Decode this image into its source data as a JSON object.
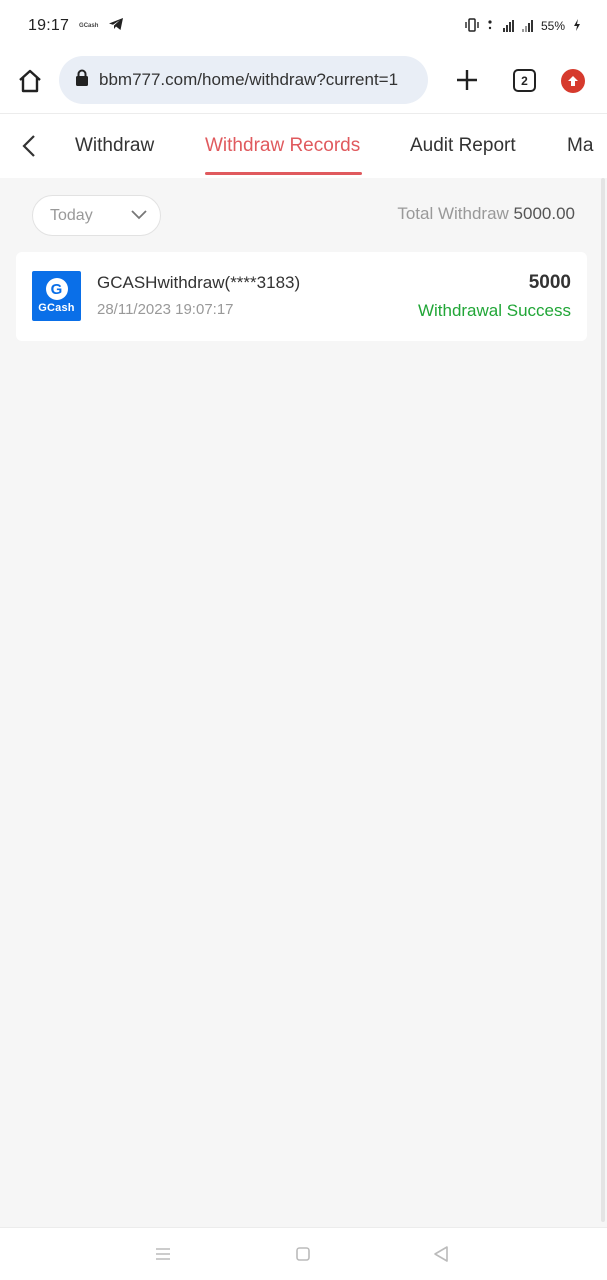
{
  "status_bar": {
    "time": "19:17",
    "app_badge": "GCash",
    "battery": "55%"
  },
  "browser": {
    "url": "bbm777.com/home/withdraw?current=1",
    "tab_count": "2"
  },
  "nav_tabs": [
    {
      "label": "Withdraw",
      "active": false
    },
    {
      "label": "Withdraw Records",
      "active": true
    },
    {
      "label": "Audit Report",
      "active": false
    },
    {
      "label": "Ma",
      "active": false
    }
  ],
  "filter": {
    "date_value": "Today",
    "total_label": "Total Withdraw",
    "total_amount": "5000.00"
  },
  "records": [
    {
      "logo_text": "GCash",
      "title": "GCASHwithdraw(****3183)",
      "datetime": "28/11/2023 19:07:17",
      "amount": "5000",
      "status": "Withdrawal Success"
    }
  ],
  "colors": {
    "accent": "#e05a5e",
    "success": "#21a637",
    "gcash_blue": "#0a6fe8"
  }
}
